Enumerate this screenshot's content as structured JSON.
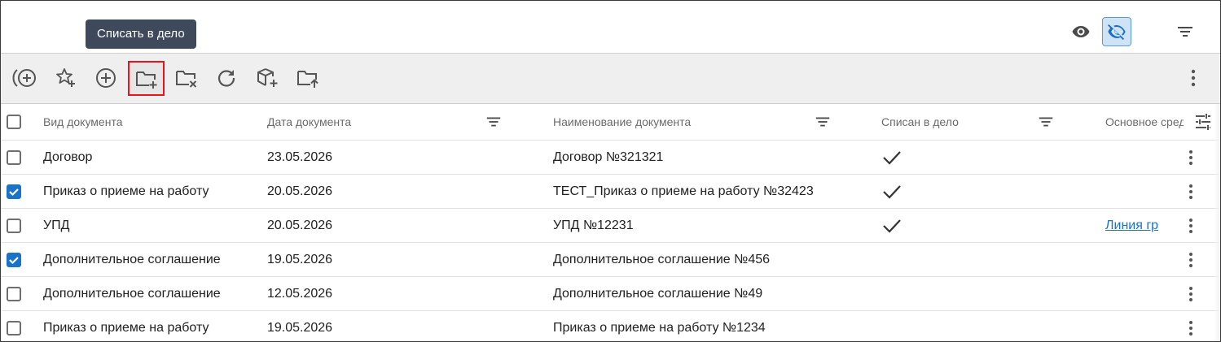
{
  "tooltip": {
    "text": "Списать в дело"
  },
  "header": {
    "show_icon": "eye-icon",
    "hide_icon": "eye-off-icon",
    "filter_icon": "filter-icon"
  },
  "toolbar": {
    "buttons": [
      {
        "icon": "add-circle-wave-icon"
      },
      {
        "icon": "star-add-icon"
      },
      {
        "icon": "add-circle-icon"
      },
      {
        "icon": "folder-add-icon",
        "highlighted": true
      },
      {
        "icon": "folder-remove-icon"
      },
      {
        "icon": "refresh-icon"
      },
      {
        "icon": "package-add-icon"
      },
      {
        "icon": "folder-upload-icon"
      }
    ],
    "more_icon": "more-vertical-icon"
  },
  "table": {
    "columns": {
      "type": "Вид документа",
      "date": "Дата документа",
      "name": "Наименование документа",
      "filed": "Списан в дело",
      "asset": "Основное сред"
    },
    "rows": [
      {
        "checked": false,
        "type": "Договор",
        "date": "23.05.2026",
        "name": "Договор №321321",
        "filed": true,
        "asset": ""
      },
      {
        "checked": true,
        "type": "Приказ о приеме на работу",
        "date": "20.05.2026",
        "name": "ТЕСТ_Приказ о приеме на работу №32423",
        "filed": true,
        "asset": ""
      },
      {
        "checked": false,
        "type": "УПД",
        "date": "20.05.2026",
        "name": "УПД №12231",
        "filed": true,
        "asset": "Линия гр"
      },
      {
        "checked": true,
        "type": "Дополнительное соглашение",
        "date": "19.05.2026",
        "name": "Дополнительное соглашение №456",
        "filed": false,
        "asset": ""
      },
      {
        "checked": false,
        "type": "Дополнительное соглашение",
        "date": "12.05.2026",
        "name": "Дополнительное соглашение №49",
        "filed": false,
        "asset": ""
      },
      {
        "checked": false,
        "type": "Приказ о приеме на работу",
        "date": "19.05.2026",
        "name": "Приказ о приеме на работу №1234",
        "filed": false,
        "asset": ""
      }
    ]
  },
  "colors": {
    "accent": "#1a73c9",
    "highlight_border": "#e8141c",
    "tooltip_bg": "#3e4a5c",
    "toolbar_bg": "#efefef",
    "active_toggle_bg": "#cfe3f7"
  }
}
